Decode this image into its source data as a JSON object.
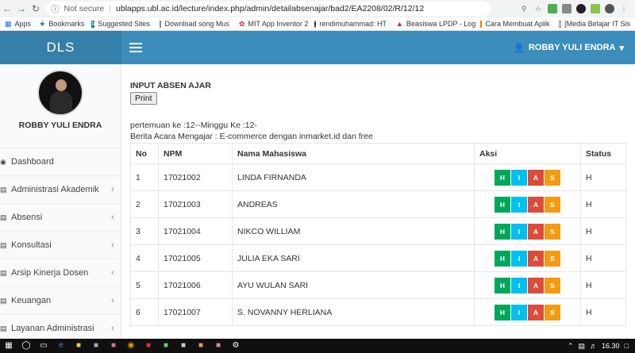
{
  "browser": {
    "secure_label": "Not secure",
    "url": "ublapps.ubl.ac.id/lecture/index.php/admin/detailabsenajar/bad2/EA2208/02/R/12/12",
    "bookmarks": [
      {
        "label": "Apps",
        "icon": "apps-grid-icon"
      },
      {
        "label": "Bookmarks",
        "icon": "star-icon"
      },
      {
        "label": "Suggested Sites",
        "icon": "bing-icon"
      },
      {
        "label": "Download song Mus",
        "icon": "page-icon"
      },
      {
        "label": "MIT App Inventor 2",
        "icon": "mit-icon"
      },
      {
        "label": "rendimuhammad: HT",
        "icon": "github-icon"
      },
      {
        "label": "Beasiswa LPDP - Log",
        "icon": "lpdp-icon"
      },
      {
        "label": "Cara Membuat Aplik",
        "icon": "blogger-icon"
      },
      {
        "label": "[Media Belajar IT Sis",
        "icon": "page-icon"
      }
    ]
  },
  "header": {
    "logo": "DLS",
    "user": "ROBBY YULI ENDRA",
    "accent": "#3c8dbc",
    "logo_bg": "#367fa9"
  },
  "sidebar": {
    "user_name": "ROBBY YULI ENDRA",
    "items": [
      {
        "label": "Dashboard",
        "icon": "dashboard-icon",
        "has_chevron": false
      },
      {
        "label": "Administrasi Akademik",
        "icon": "list-icon",
        "has_chevron": true
      },
      {
        "label": "Absensi",
        "icon": "book-icon",
        "has_chevron": true
      },
      {
        "label": "Konsultasi",
        "icon": "chat-icon",
        "has_chevron": true
      },
      {
        "label": "Arsip Kinerja Dosen",
        "icon": "archive-icon",
        "has_chevron": true
      },
      {
        "label": "Keuangan",
        "icon": "money-icon",
        "has_chevron": true
      },
      {
        "label": "Layanan Administrasi",
        "icon": "service-icon",
        "has_chevron": true
      }
    ]
  },
  "main": {
    "title": "INPUT ABSEN AJAR",
    "print_label": "Print",
    "meeting_line": "pertemuan ke :12--Minggu Ke :12-",
    "berita_line": "Berita Acara Mengajar : E-commerce dengan inmarket.id dan free",
    "table": {
      "headers": [
        "No",
        "NPM",
        "Nama Mahasiswa",
        "Aksi",
        "Status"
      ],
      "aksi_buttons": [
        {
          "label": "H",
          "color": "#00a65a"
        },
        {
          "label": "I",
          "color": "#00c0ef"
        },
        {
          "label": "A",
          "color": "#dd4b39"
        },
        {
          "label": "S",
          "color": "#f39c12"
        }
      ],
      "rows": [
        {
          "no": "1",
          "npm": "17021002",
          "nama": "LINDA FIRNANDA",
          "status": "H"
        },
        {
          "no": "2",
          "npm": "17021003",
          "nama": "ANDREAS",
          "status": "H"
        },
        {
          "no": "3",
          "npm": "17021004",
          "nama": "NIKCO WILLIAM",
          "status": "H"
        },
        {
          "no": "4",
          "npm": "17021005",
          "nama": "JULIA EKA SARI",
          "status": "H"
        },
        {
          "no": "5",
          "npm": "17021006",
          "nama": "AYU WULAN SARI",
          "status": "H"
        },
        {
          "no": "6",
          "npm": "17021007",
          "nama": "S. NOVANNY HERLIANA",
          "status": "H"
        }
      ]
    }
  },
  "taskbar": {
    "time": "16.30"
  }
}
